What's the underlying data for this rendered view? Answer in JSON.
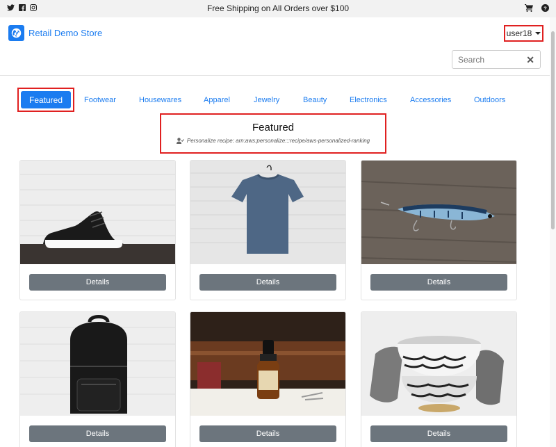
{
  "topbar": {
    "promo": "Free Shipping on All Orders over $100",
    "social_icons": [
      "twitter-icon",
      "facebook-icon",
      "instagram-icon"
    ],
    "right_icons": [
      "cart-icon",
      "help-icon"
    ]
  },
  "header": {
    "brand": "Retail Demo Store",
    "user": "user18",
    "search": {
      "placeholder": "Search",
      "value": ""
    }
  },
  "nav": {
    "active": "Featured",
    "items": [
      "Footwear",
      "Housewares",
      "Apparel",
      "Jewelry",
      "Beauty",
      "Electronics",
      "Accessories",
      "Outdoors"
    ]
  },
  "featured": {
    "title": "Featured",
    "recipe": "Personalize recipe: arn:aws:personalize:::recipe/aws-personalized-ranking"
  },
  "products": [
    {
      "image": "black running shoe",
      "button": "Details"
    },
    {
      "image": "blue t-shirt on hanger",
      "button": "Details"
    },
    {
      "image": "fishing lure on wood",
      "button": "Details"
    },
    {
      "image": "black leather backpack",
      "button": "Details"
    },
    {
      "image": "serum dropper bottle",
      "button": "Details"
    },
    {
      "image": "stacked patterned bowls",
      "button": "Details"
    }
  ],
  "colors": {
    "accent": "#1b7cf0",
    "highlight": "#e02020",
    "button": "#6c757d"
  }
}
